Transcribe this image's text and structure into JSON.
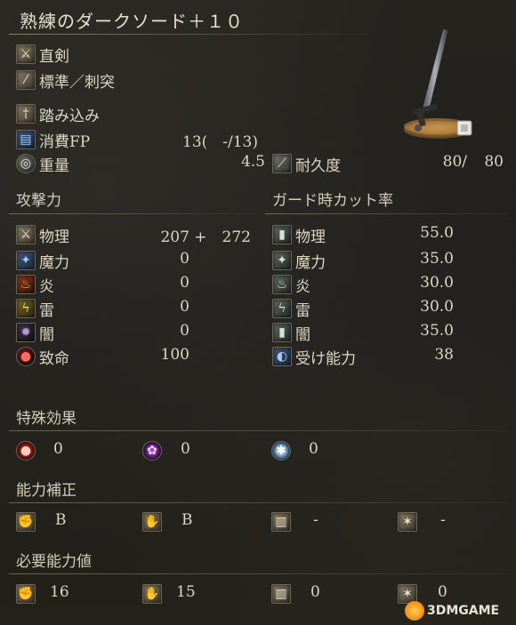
{
  "title": "熟練のダークソード＋１０",
  "header": {
    "category": "直剣",
    "attack_type": "標準／刺突",
    "skill": "踏み込み",
    "fp_label": "消費FP",
    "fp_value": "13(　-/13)",
    "weight_label": "重量",
    "weight_value": "4.5",
    "durability_label": "耐久度",
    "durability_current": "80/",
    "durability_max": "80"
  },
  "attack": {
    "heading": "攻撃力",
    "rows": [
      {
        "label": "物理",
        "value": "207 +　272",
        "icon": "sword-icon"
      },
      {
        "label": "魔力",
        "value": "0",
        "icon": "magic-icon"
      },
      {
        "label": "炎",
        "value": "0",
        "icon": "fire-icon"
      },
      {
        "label": "雷",
        "value": "0",
        "icon": "lightning-icon"
      },
      {
        "label": "闇",
        "value": "0",
        "icon": "dark-icon"
      },
      {
        "label": "致命",
        "value": "100",
        "icon": "critical-icon"
      }
    ]
  },
  "guard": {
    "heading": "ガード時カット率",
    "rows": [
      {
        "label": "物理",
        "value": "55.0",
        "icon": "shield-physical-icon"
      },
      {
        "label": "魔力",
        "value": "35.0",
        "icon": "shield-magic-icon"
      },
      {
        "label": "炎",
        "value": "30.0",
        "icon": "shield-fire-icon"
      },
      {
        "label": "雷",
        "value": "30.0",
        "icon": "shield-lightning-icon"
      },
      {
        "label": "闇",
        "value": "35.0",
        "icon": "shield-dark-icon"
      },
      {
        "label": "受け能力",
        "value": "38",
        "icon": "stability-icon"
      }
    ]
  },
  "special": {
    "heading": "特殊効果",
    "items": [
      {
        "icon": "bleed-icon",
        "value": "0"
      },
      {
        "icon": "poison-icon",
        "value": "0"
      },
      {
        "icon": "frost-icon",
        "value": "0"
      }
    ]
  },
  "scaling": {
    "heading": "能力補正",
    "items": [
      {
        "icon": "strength-icon",
        "value": "B"
      },
      {
        "icon": "dexterity-icon",
        "value": "B"
      },
      {
        "icon": "intelligence-icon",
        "value": "-"
      },
      {
        "icon": "faith-icon",
        "value": "-"
      }
    ]
  },
  "requirements": {
    "heading": "必要能力値",
    "items": [
      {
        "icon": "strength-icon",
        "value": "16"
      },
      {
        "icon": "dexterity-icon",
        "value": "15"
      },
      {
        "icon": "intelligence-icon",
        "value": "0"
      },
      {
        "icon": "faith-icon",
        "value": "0"
      }
    ]
  },
  "watermark": "3DMGAME"
}
